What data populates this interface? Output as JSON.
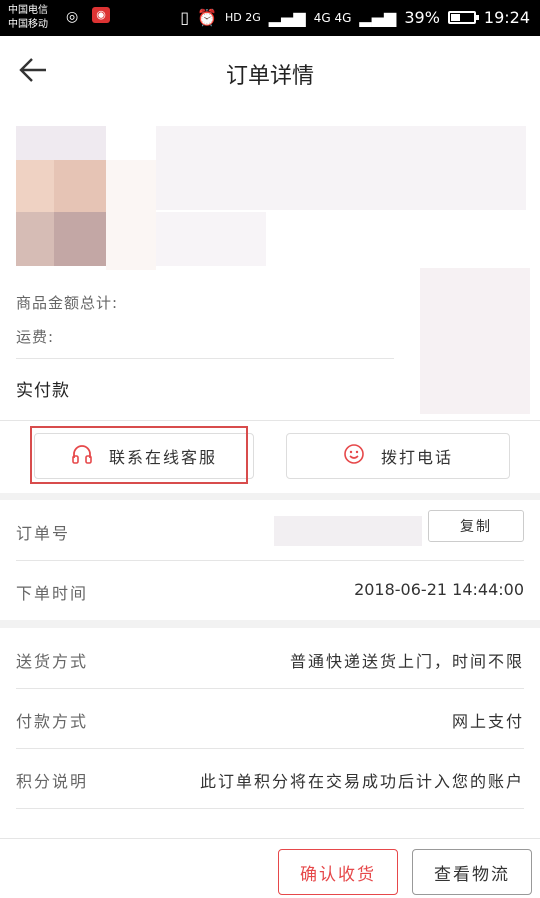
{
  "status_bar": {
    "carrier1": "中国电信",
    "carrier2": "中国移动",
    "network1": "HD 2G",
    "network2": "4G 4G",
    "battery": "39%",
    "time": "19:24"
  },
  "header": {
    "back_icon": "arrow-left-icon",
    "title": "订单详情"
  },
  "product": {
    "total_label": "商品金额总计:",
    "shipping_label": "运费:",
    "paid_label": "实付款"
  },
  "actions": {
    "service_label": "联系在线客服",
    "service_icon": "headphones-icon",
    "call_label": "拨打电话",
    "call_icon": "smiley-icon",
    "accent_color": "#e6484a"
  },
  "order": {
    "number_label": "订单号",
    "copy_label": "复制",
    "time_label": "下单时间",
    "time_value": "2018-06-21  14:44:00"
  },
  "details": {
    "delivery_label": "送货方式",
    "delivery_value": "普通快递送货上门，时间不限",
    "payment_label": "付款方式",
    "payment_value": "网上支付",
    "points_label": "积分说明",
    "points_value": "此订单积分将在交易成功后计入您的账户"
  },
  "footer": {
    "confirm_label": "确认收货",
    "logistics_label": "查看物流"
  }
}
